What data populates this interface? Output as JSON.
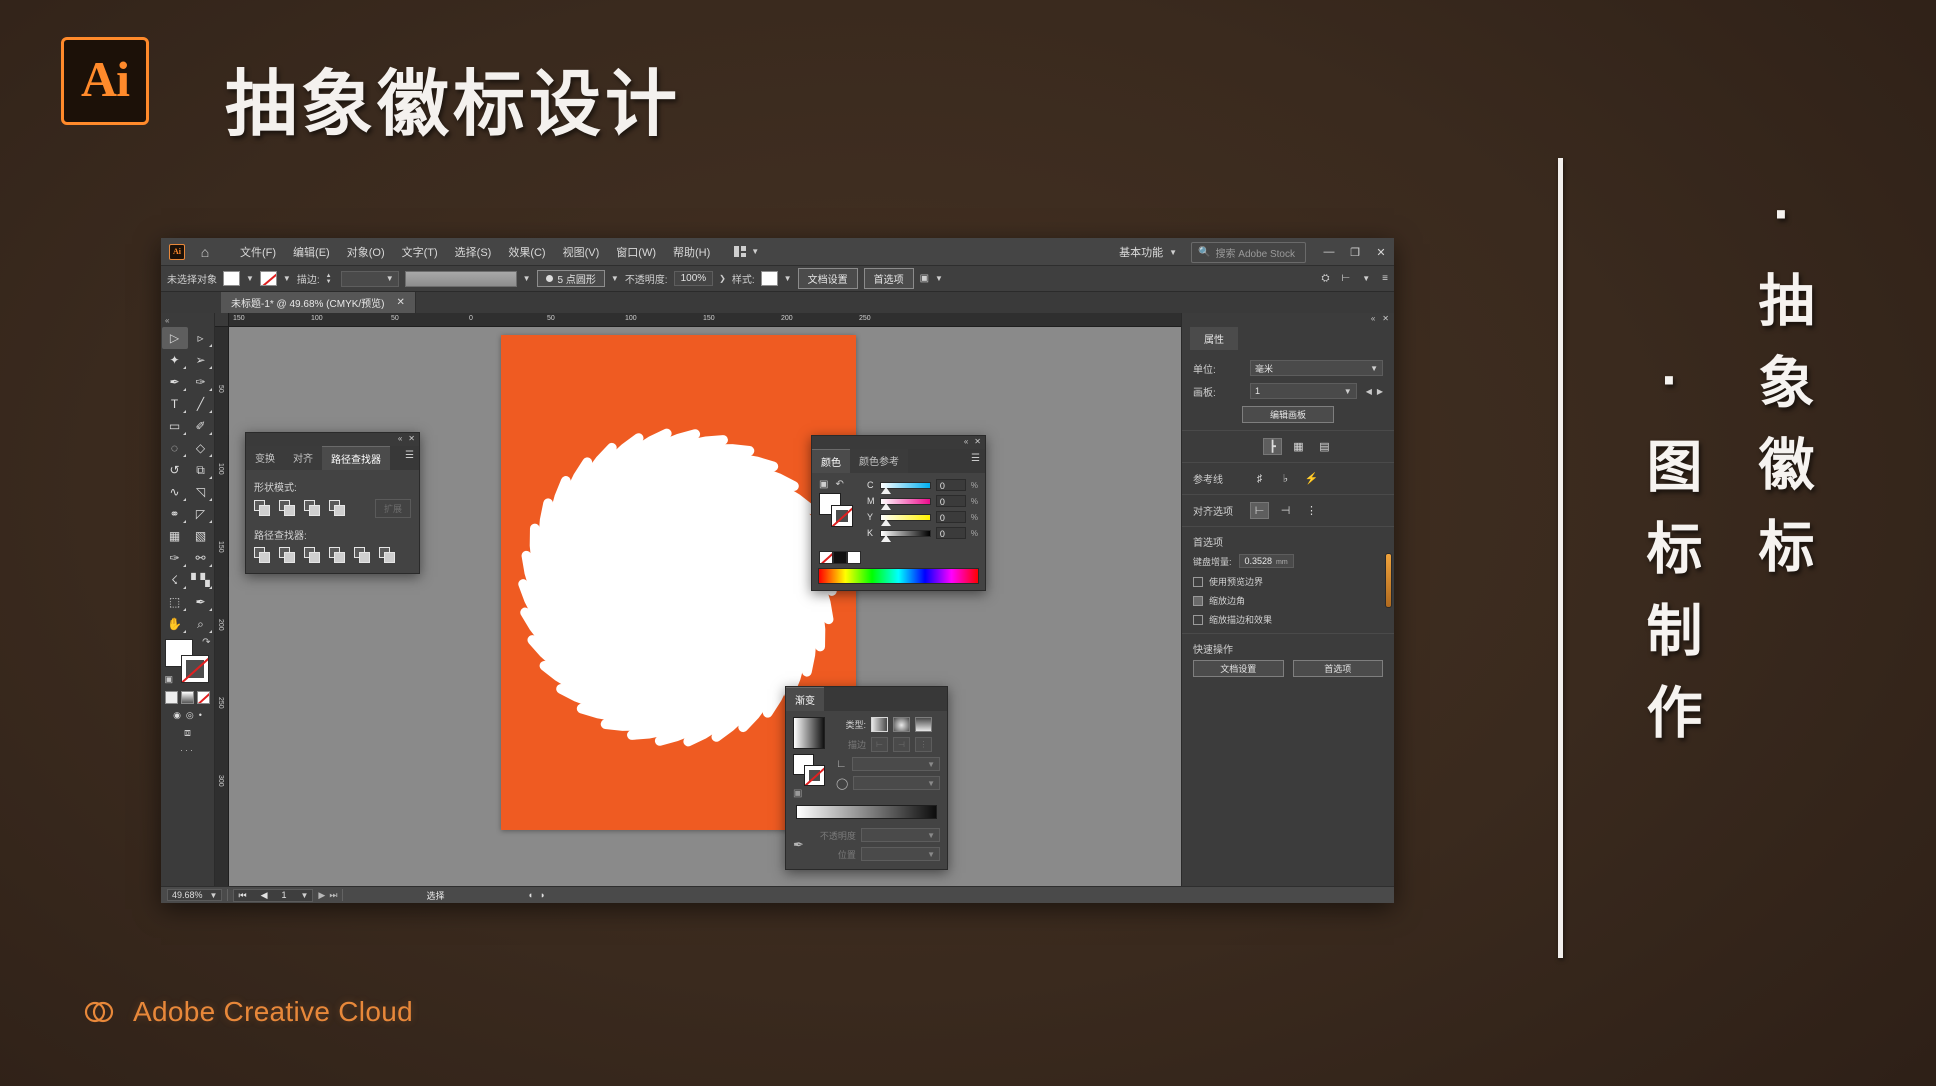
{
  "header": {
    "app_badge": "Ai",
    "title": "抽象徽标设计"
  },
  "vertical_text": {
    "right_column": "·抽象徽标",
    "left_column": "·图标制作"
  },
  "footer": {
    "logo_icon": "creative-cloud-icon",
    "label": "Adobe Creative Cloud",
    "accent_color": "#e8883a"
  },
  "app": {
    "menubar": {
      "app_icon": "ai-app-icon",
      "home_icon": "home-icon",
      "items": [
        {
          "label": "文件(F)"
        },
        {
          "label": "编辑(E)"
        },
        {
          "label": "对象(O)"
        },
        {
          "label": "文字(T)"
        },
        {
          "label": "选择(S)"
        },
        {
          "label": "效果(C)"
        },
        {
          "label": "视图(V)"
        },
        {
          "label": "窗口(W)"
        },
        {
          "label": "帮助(H)"
        }
      ],
      "arrange_icon": "arrange-documents-icon",
      "workspace": "基本功能",
      "search_placeholder": "搜索 Adobe Stock",
      "minimize": "—",
      "restore": "❐",
      "close": "✕"
    },
    "controlbar": {
      "selection_status": "未选择对象",
      "fill_label": "fill-swatch",
      "stroke_label": "stroke-swatch",
      "stroke_weight_label": "描边:",
      "stroke_weight_value": "",
      "stroke_profile": "stroke-profile-preview",
      "brush_value": "5 点圆形",
      "opacity_label": "不透明度:",
      "opacity_value": "100%",
      "style_label": "样式:",
      "doc_setup_button": "文档设置",
      "preferences_button": "首选项",
      "select_similar_icon": "select-similar-icon",
      "transform_icon": "transform-icon",
      "align_icon": "align-icon",
      "options_icon": "panel-options-icon"
    },
    "document_tab": {
      "title": "未标题-1* @ 49.68% (CMYK/预览)",
      "close": "✕"
    },
    "toolbar": {
      "tools": [
        {
          "name": "selection-tool",
          "glyph": "▷",
          "active": true
        },
        {
          "name": "direct-selection-tool",
          "glyph": "▹",
          "active": false
        },
        {
          "name": "magic-wand-tool",
          "glyph": "✨",
          "active": false
        },
        {
          "name": "lasso-tool",
          "glyph": "➦",
          "active": false
        },
        {
          "name": "pen-tool",
          "glyph": "✒",
          "active": false
        },
        {
          "name": "curvature-tool",
          "glyph": "✎",
          "active": false
        },
        {
          "name": "type-tool",
          "glyph": "T",
          "active": false
        },
        {
          "name": "line-segment-tool",
          "glyph": "╱",
          "active": false
        },
        {
          "name": "rectangle-tool",
          "glyph": "▭",
          "active": false
        },
        {
          "name": "paintbrush-tool",
          "glyph": "✐",
          "active": false
        },
        {
          "name": "shaper-tool",
          "glyph": "○",
          "active": false
        },
        {
          "name": "eraser-tool",
          "glyph": "◇",
          "active": false
        },
        {
          "name": "rotate-tool",
          "glyph": "↺",
          "active": false
        },
        {
          "name": "scale-tool",
          "glyph": "⧉",
          "active": false
        },
        {
          "name": "width-tool",
          "glyph": "≈",
          "active": false
        },
        {
          "name": "free-transform-tool",
          "glyph": "◱",
          "active": false
        },
        {
          "name": "shape-builder-tool",
          "glyph": "⚭",
          "active": false
        },
        {
          "name": "perspective-grid-tool",
          "glyph": "◸",
          "active": false
        },
        {
          "name": "mesh-tool",
          "glyph": "░",
          "active": false
        },
        {
          "name": "gradient-tool",
          "glyph": "▧",
          "active": false
        },
        {
          "name": "eyedropper-tool",
          "glyph": "✑",
          "active": false
        },
        {
          "name": "blend-tool",
          "glyph": "⚯",
          "active": false
        },
        {
          "name": "symbol-sprayer-tool",
          "glyph": "⚇",
          "active": false
        },
        {
          "name": "column-graph-tool",
          "glyph": "☰",
          "active": false
        },
        {
          "name": "artboard-tool",
          "glyph": "⬚",
          "active": false
        },
        {
          "name": "slice-tool",
          "glyph": "✂",
          "active": false
        },
        {
          "name": "hand-tool",
          "glyph": "✋",
          "active": false
        },
        {
          "name": "zoom-tool",
          "glyph": "⌕",
          "active": false
        }
      ],
      "fill_stroke": {
        "fill": "#ffffff",
        "stroke": "none",
        "swap_icon": "swap-fill-stroke-icon",
        "default_icon": "default-fill-stroke-icon"
      },
      "color_modes": [
        "color-mode",
        "gradient-mode",
        "none-mode"
      ],
      "screen_modes": [
        "draw-normal-icon",
        "draw-behind-icon",
        "draw-inside-icon"
      ],
      "change_screen_mode": "change-screen-mode-icon",
      "more_tools": "···"
    },
    "canvas": {
      "ruler_h_ticks": [
        "150",
        "100",
        "50",
        "0",
        "50",
        "100",
        "150",
        "200",
        "250"
      ],
      "ruler_v_ticks": [
        "50",
        "100",
        "150",
        "200",
        "250",
        "300"
      ],
      "artboard_color": "#ef5b22",
      "artwork_name": "spiral-logo-artwork"
    },
    "pathfinder_panel": {
      "tabs": [
        {
          "label": "变换",
          "active": false
        },
        {
          "label": "对齐",
          "active": false
        },
        {
          "label": "路径查找器",
          "active": true
        }
      ],
      "menu_icon": "panel-menu-icon",
      "shape_modes_label": "形状模式:",
      "shape_mode_buttons": [
        "unite",
        "minus-front",
        "intersect",
        "exclude"
      ],
      "expand_button": "扩展",
      "pathfinders_label": "路径查找器:",
      "pathfinder_buttons": [
        "divide",
        "trim",
        "merge",
        "crop",
        "outline",
        "minus-back"
      ],
      "collapse_icon": "«",
      "close_icon": "✕"
    },
    "color_panel": {
      "tabs": [
        {
          "label": "颜色",
          "active": true
        },
        {
          "label": "颜色参考",
          "active": false
        }
      ],
      "menu_icon": "panel-menu-icon",
      "mode_icons": [
        "fill-stroke-toggle-icon",
        "revert-icon"
      ],
      "sliders": [
        {
          "key": "C",
          "value": "0"
        },
        {
          "key": "M",
          "value": "0"
        },
        {
          "key": "Y",
          "value": "0"
        },
        {
          "key": "K",
          "value": "0"
        }
      ],
      "swatches": [
        "none",
        "black",
        "white"
      ],
      "spectrum": "color-spectrum-bar",
      "collapse_icon": "«",
      "close_icon": "✕"
    },
    "gradient_panel": {
      "title": "渐变",
      "type_label": "类型:",
      "type_buttons": [
        "linear-gradient",
        "radial-gradient",
        "freeform-gradient"
      ],
      "stroke_label": "描边",
      "stroke_buttons": [
        "stroke-within",
        "stroke-along",
        "stroke-across"
      ],
      "angle_label": "angle-field",
      "aspect_label": "aspect-ratio-field",
      "gradient_bar": "gradient-slider",
      "opacity_label": "不透明度",
      "location_label": "位置",
      "eyedropper_icon": "gradient-eyedropper-icon"
    },
    "properties_panel": {
      "title": "属性",
      "menu_icon": "panel-menu-icon",
      "unit_label": "单位:",
      "unit_value": "毫米",
      "artboard_label": "画板:",
      "artboard_value": "1",
      "edit_artboards_button": "编辑画板",
      "ruler_icons": [
        "rulers-icon",
        "grid-icon",
        "transparency-grid-icon"
      ],
      "guides_label": "参考线",
      "guides_icons": [
        "show-guides-icon",
        "lock-guides-icon",
        "smart-guides-icon"
      ],
      "align_label": "对齐选项",
      "align_icons": [
        "align-to-selection-icon",
        "align-to-key-object-icon",
        "align-to-artboard-icon"
      ],
      "prefs_label": "首选项",
      "keyboard_increment_label": "键盘增量:",
      "keyboard_increment_value": "0.3528",
      "keyboard_increment_unit": "mm",
      "checkboxes": [
        {
          "label": "使用预览边界",
          "checked": false
        },
        {
          "label": "缩放边角",
          "checked": true
        },
        {
          "label": "缩放描边和效果",
          "checked": false
        }
      ],
      "quick_actions_label": "快速操作",
      "quick_actions": [
        "文档设置",
        "首选项"
      ],
      "collapse_icon": "«",
      "close_icon": "✕"
    },
    "statusbar": {
      "zoom_value": "49.68%",
      "first_page_icon": "⏮",
      "prev_page_icon": "◀",
      "page_value": "1",
      "next_page_icon": "▶",
      "last_page_icon": "⏭",
      "status_text": "选择",
      "nav_prev": "◖",
      "nav_next": "◗"
    }
  }
}
